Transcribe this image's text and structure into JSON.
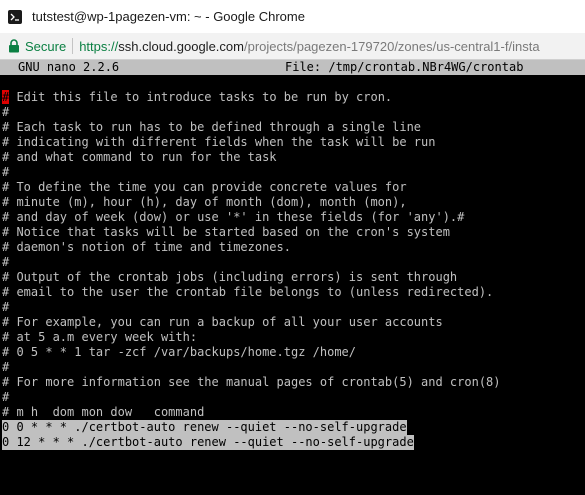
{
  "window": {
    "title": "tutstest@wp-1pagezen-vm: ~ - Google Chrome"
  },
  "address_bar": {
    "secure_label": "Secure",
    "url_scheme": "https://",
    "url_host": "ssh.cloud.google.com",
    "url_path": "/projects/pagezen-179720/zones/us-central1-f/insta"
  },
  "nano": {
    "version": "GNU nano 2.2.6",
    "file_label": "File: /tmp/crontab.NBr4WG/crontab"
  },
  "editor": {
    "cursor_char": "#",
    "first_line_rest": " Edit this file to introduce tasks to be run by cron.",
    "lines": [
      "#",
      "# Each task to run has to be defined through a single line",
      "# indicating with different fields when the task will be run",
      "# and what command to run for the task",
      "#",
      "# To define the time you can provide concrete values for",
      "# minute (m), hour (h), day of month (dom), month (mon),",
      "# and day of week (dow) or use '*' in these fields (for 'any').#",
      "# Notice that tasks will be started based on the cron's system",
      "# daemon's notion of time and timezones.",
      "#",
      "# Output of the crontab jobs (including errors) is sent through",
      "# email to the user the crontab file belongs to (unless redirected).",
      "#",
      "# For example, you can run a backup of all your user accounts",
      "# at 5 a.m every week with:",
      "# 0 5 * * 1 tar -zcf /var/backups/home.tgz /home/",
      "#",
      "# For more information see the manual pages of crontab(5) and cron(8)",
      "#",
      "# m h  dom mon dow   command"
    ],
    "selected_lines": [
      "0 0 * * * ./certbot-auto renew --quiet --no-self-upgrade",
      "0 12 * * * ./certbot-auto renew --quiet --no-self-upgrade"
    ]
  }
}
